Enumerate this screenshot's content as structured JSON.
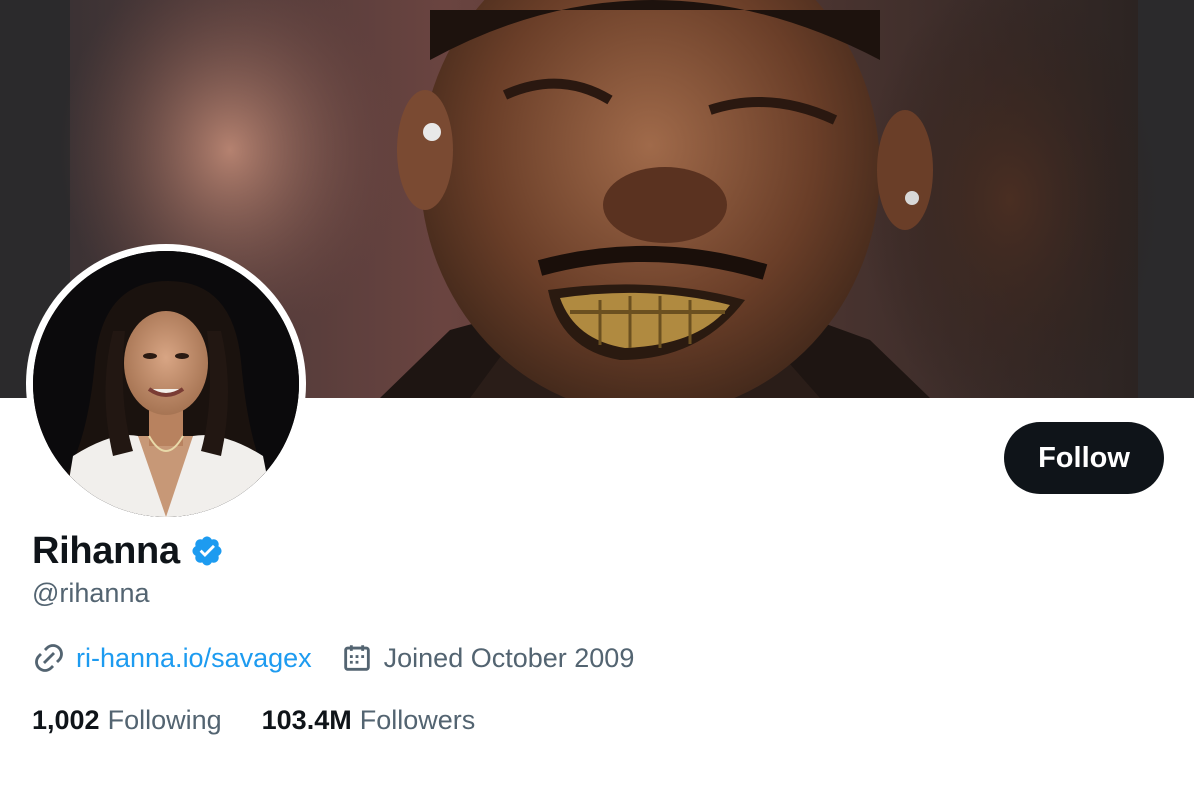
{
  "profile": {
    "display_name": "Rihanna",
    "handle": "@rihanna",
    "verified": true,
    "website": "ri-hanna.io/savagex",
    "joined": "Joined October 2009",
    "follow_label": "Follow",
    "following_count": "1,002",
    "following_label": "Following",
    "followers_count": "103.4M",
    "followers_label": "Followers"
  },
  "icons": {
    "verified": "verified-badge-icon",
    "link": "link-icon",
    "calendar": "calendar-icon"
  },
  "colors": {
    "primary_text": "#0f1419",
    "secondary_text": "#536471",
    "accent": "#1d9bf0",
    "button_bg": "#0f1419"
  }
}
